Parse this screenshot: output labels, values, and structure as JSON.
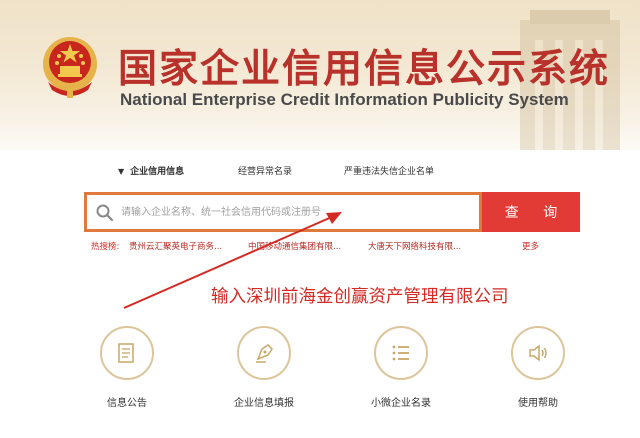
{
  "header": {
    "title_cn": "国家企业信用信息公示系统",
    "title_en": "National Enterprise Credit Information Publicity System"
  },
  "tabs": [
    {
      "label": "企业信用信息",
      "active": true
    },
    {
      "label": "经营异常名录",
      "active": false
    },
    {
      "label": "严重违法失信企业名单",
      "active": false
    }
  ],
  "search": {
    "placeholder": "请输入企业名称、统一社会信用代码或注册号",
    "button_label": "查 询"
  },
  "hot_search": {
    "label": "热搜榜:",
    "items": [
      "贵州云汇聚英电子商务...",
      "中国移动通信集团有限...",
      "大唐天下网络科技有限..."
    ],
    "more_label": "更多"
  },
  "annotation": "输入深圳前海金创赢资产管理有限公司",
  "features": [
    {
      "label": "信息公告",
      "icon": "document-icon"
    },
    {
      "label": "企业信息填报",
      "icon": "pen-nib-icon"
    },
    {
      "label": "小微企业名录",
      "icon": "list-icon"
    },
    {
      "label": "使用帮助",
      "icon": "speaker-icon"
    }
  ],
  "colors": {
    "brand_red": "#b8312a",
    "button_red": "#e23a35",
    "search_border": "#e07a3c",
    "icon_ring": "#dcc59a"
  }
}
